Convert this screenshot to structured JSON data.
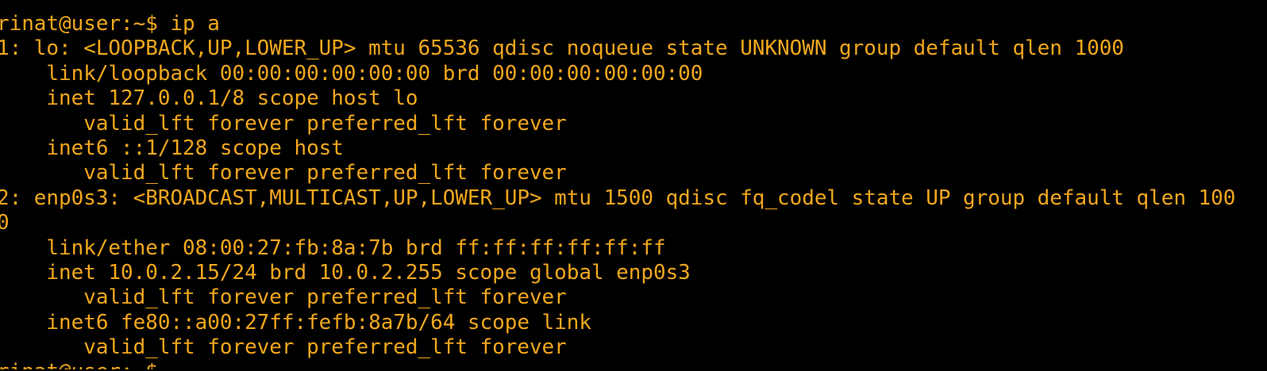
{
  "terminal": {
    "text_color": "#f2a81d",
    "background": "#000000",
    "lines": [
      "rinat@user:~$ ip a",
      "1: lo: <LOOPBACK,UP,LOWER_UP> mtu 65536 qdisc noqueue state UNKNOWN group default qlen 1000",
      "    link/loopback 00:00:00:00:00:00 brd 00:00:00:00:00:00",
      "    inet 127.0.0.1/8 scope host lo",
      "       valid_lft forever preferred_lft forever",
      "    inet6 ::1/128 scope host",
      "       valid_lft forever preferred_lft forever",
      "2: enp0s3: <BROADCAST,MULTICAST,UP,LOWER_UP> mtu 1500 qdisc fq_codel state UP group default qlen 100",
      "0",
      "    link/ether 08:00:27:fb:8a:7b brd ff:ff:ff:ff:ff:ff",
      "    inet 10.0.2.15/24 brd 10.0.2.255 scope global enp0s3",
      "       valid_lft forever preferred_lft forever",
      "    inet6 fe80::a00:27ff:fefb:8a7b/64 scope link",
      "       valid_lft forever preferred_lft forever",
      "rinat@user:~$ "
    ]
  }
}
